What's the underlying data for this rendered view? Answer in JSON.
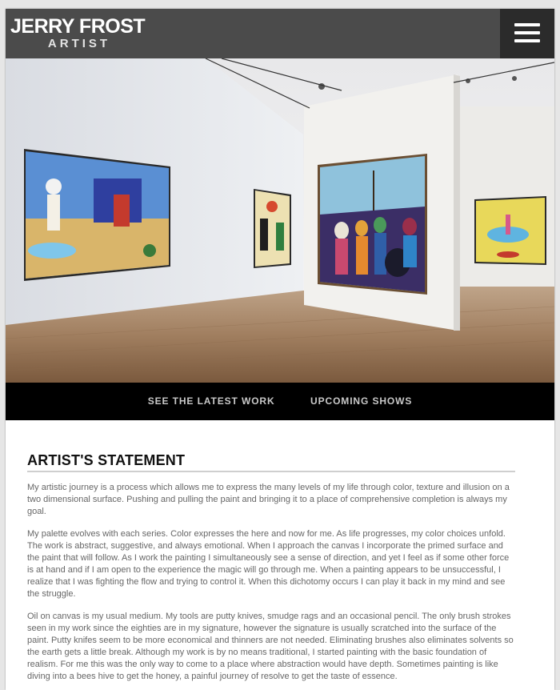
{
  "brand": {
    "name": "JERRY FROST",
    "subtitle": "ARTIST"
  },
  "menu": {
    "icon": "hamburger-menu-icon"
  },
  "hero": {
    "alt": "Gallery installation view"
  },
  "nav": {
    "items": [
      "SEE THE LATEST WORK",
      "UPCOMING SHOWS"
    ]
  },
  "statement": {
    "heading": "ARTIST'S STATEMENT",
    "paragraphs": [
      "My artistic journey is a process which allows me to express the many levels of my life through color, texture and illusion on a two dimensional surface. Pushing and pulling the paint and bringing it to a place of comprehensive completion is always my goal.",
      "My palette evolves with each series. Color expresses the here and now for me. As life progresses, my color choices unfold. The work is abstract, suggestive, and always emotional. When I approach the canvas I incorporate the primed surface and the paint that will follow. As I work the painting I simultaneously see a sense of direction, and yet I feel as if some other force is at hand and if I am open to the experience the magic will go through me. When a painting appears to be unsuccessful, I realize that I was fighting the flow and trying to control it. When this dichotomy occurs I can play it back in my mind and see the struggle.",
      "Oil on canvas is my usual medium. My tools are putty knives, smudge rags and an occasional pencil. The only brush strokes seen in my work since the eighties are in my signature, however the signature is usually scratched into the surface of the paint. Putty knifes seem to be more economical and thinners are not needed. Eliminating brushes also eliminates solvents so the earth gets a little break. Although my work is by no means traditional, I started painting with the basic foundation of realism. For me this was the only way to come to a place where abstraction would have depth. Sometimes painting is like diving into a bees hive to get the honey, a painful journey of resolve to get the taste of essence."
    ]
  },
  "colors": {
    "header_bg": "#4b4b4b",
    "menu_bg": "#2b2b2b",
    "nav_bg": "#000000",
    "nav_text": "#c9c9c9",
    "body_text": "#666666"
  }
}
